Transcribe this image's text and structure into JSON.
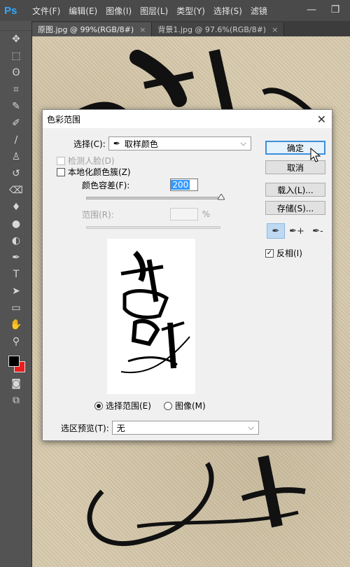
{
  "app": {
    "logo": "Ps"
  },
  "menu": [
    "文件(F)",
    "编辑(E)",
    "图像(I)",
    "图层(L)",
    "类型(Y)",
    "选择(S)",
    "滤镜"
  ],
  "tabs": [
    {
      "label": "原图.jpg @ 99%(RGB/8#)",
      "close": "×"
    },
    {
      "label": "背景1.jpg @ 97.6%(RGB/8#)",
      "close": "×"
    }
  ],
  "window_buttons": {
    "minimize": "—",
    "restore": "❐"
  },
  "tools": [
    "move-icon",
    "marquee-icon",
    "lasso-icon",
    "crop-icon",
    "eyedropper-icon",
    "healing-icon",
    "brush-icon",
    "stamp-icon",
    "history-brush-icon",
    "eraser-icon",
    "bucket-icon",
    "blur-icon",
    "dodge-icon",
    "pen-icon",
    "type-icon",
    "path-select-icon",
    "shape-icon",
    "hand-icon",
    "zoom-icon"
  ],
  "tool_glyphs": [
    "✥",
    "⬚",
    "ʘ",
    "⌗",
    "✎",
    "✐",
    "∕",
    "♙",
    "↺",
    "⌫",
    "♦",
    "●",
    "◐",
    "✒",
    "T",
    "➤",
    "▭",
    "✋",
    "⚲"
  ],
  "colors": {
    "foreground": "#000000",
    "background": "#ee1c1c",
    "accent": "#3c8fdc"
  },
  "dialog": {
    "title": "色彩范围",
    "close": "✕",
    "select_label": "选择(C):",
    "select_value": "取样颜色",
    "select_icon": "✒",
    "detect_faces": "检测人脸(D)",
    "localized": "本地化颜色簇(Z)",
    "fuzziness_label": "颜色容差(F):",
    "fuzziness_value": "200",
    "range_label": "范围(R):",
    "range_unit": "%",
    "radio_selection": "选择范围(E)",
    "radio_image": "图像(M)",
    "preview_label": "选区预览(T):",
    "preview_value": "无",
    "dropdown_arrow": "⌵",
    "buttons": {
      "ok": "确定",
      "cancel": "取消",
      "load": "载入(L)...",
      "save": "存储(S)..."
    },
    "invert_label": "反相(I)",
    "invert_check": "✓",
    "eyedroppers": [
      "✒",
      "✒+",
      "✒-"
    ]
  }
}
